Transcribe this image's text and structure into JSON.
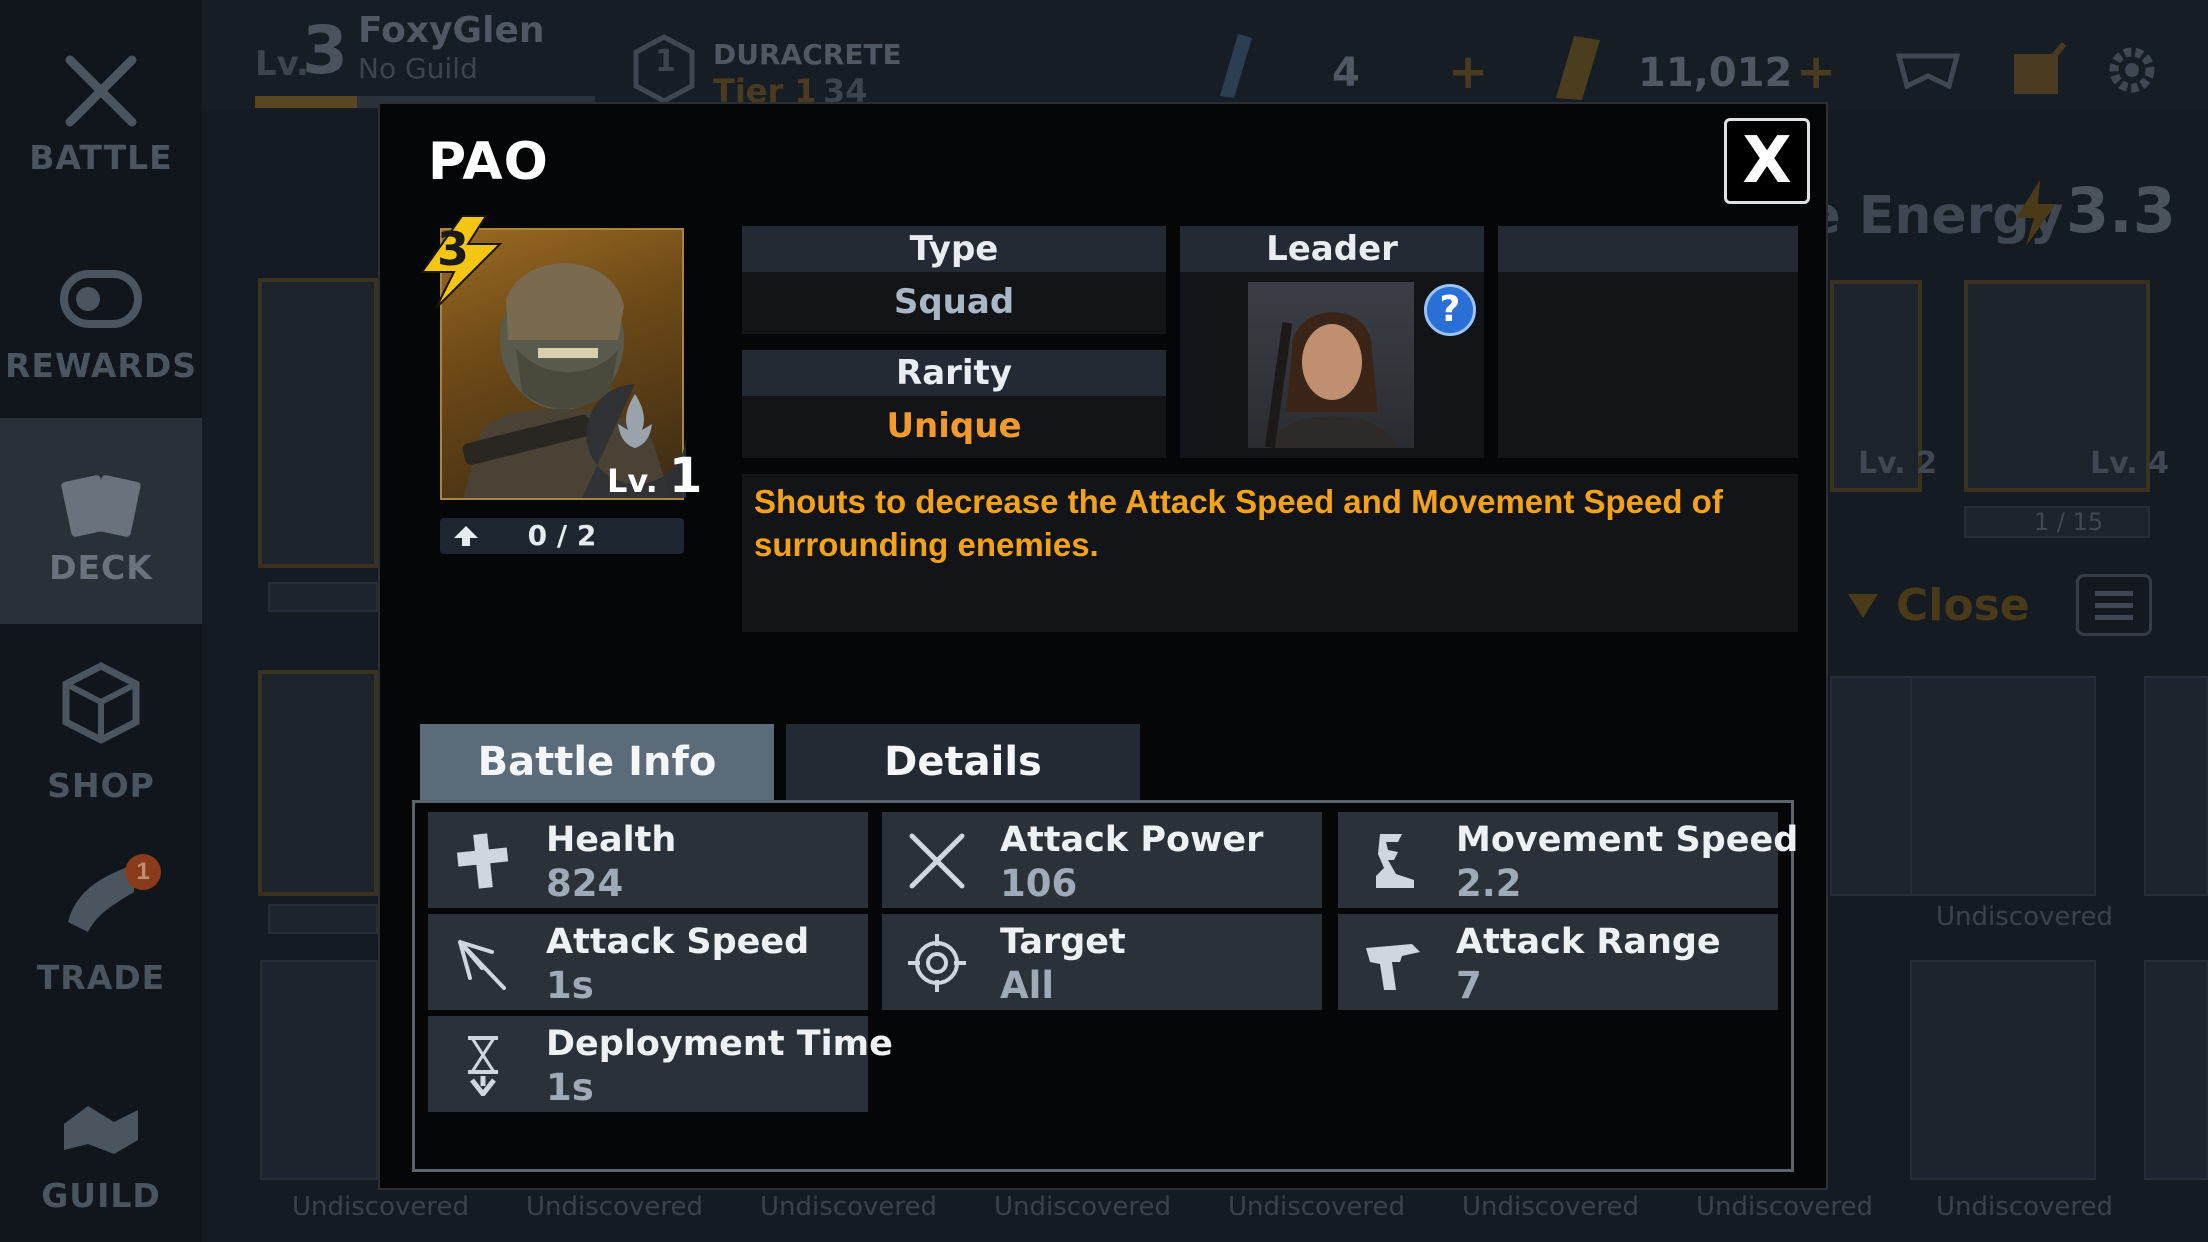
{
  "background": {
    "sidebar": {
      "items": [
        {
          "label": "BATTLE",
          "icon": "battle-icon"
        },
        {
          "label": "REWARDS",
          "icon": "rewards-icon"
        },
        {
          "label": "DECK",
          "icon": "deck-icon"
        },
        {
          "label": "SHOP",
          "icon": "shop-icon"
        },
        {
          "label": "TRADE",
          "icon": "trade-icon",
          "badge": "1"
        },
        {
          "label": "GUILD",
          "icon": "guild-icon"
        }
      ]
    },
    "player": {
      "level_prefix": "Lv.",
      "level": "3",
      "name": "FoxyGlen",
      "guild": "No Guild"
    },
    "league": {
      "name": "DURACRETE",
      "tier": "Tier 1",
      "points": "34",
      "rank_number": "1"
    },
    "currency": {
      "crystals": "4",
      "credits": "11,012",
      "plus": "+"
    },
    "deck": {
      "avg_label": "Average Energy Cost",
      "avg_value": "3.3",
      "sort_label": "Close",
      "card_levels": [
        "Lv. 2",
        "Lv. 4"
      ],
      "card_progress": "1 / 15",
      "undiscovered": "Undiscovered"
    }
  },
  "modal": {
    "title": "PAO",
    "close_label": "X",
    "card": {
      "energy_cost": "3",
      "level_prefix": "Lv.",
      "level": "1",
      "shards": "0 / 2",
      "shards_progress": 0
    },
    "type": {
      "label": "Type",
      "value": "Squad"
    },
    "rarity": {
      "label": "Rarity",
      "value": "Unique"
    },
    "leader": {
      "label": "Leader",
      "help": "?"
    },
    "description": "Shouts to decrease the Attack Speed and Movement Speed of surrounding enemies.",
    "tabs": [
      {
        "label": "Battle Info",
        "active": true
      },
      {
        "label": "Details",
        "active": false
      }
    ],
    "stats": [
      {
        "label": "Health",
        "value": "824",
        "icon": "health-icon"
      },
      {
        "label": "Attack Power",
        "value": "106",
        "icon": "attack-power-icon"
      },
      {
        "label": "Movement Speed",
        "value": "2.2",
        "icon": "movement-speed-icon"
      },
      {
        "label": "Attack Speed",
        "value": "1s",
        "icon": "attack-speed-icon"
      },
      {
        "label": "Target",
        "value": "All",
        "icon": "target-icon"
      },
      {
        "label": "Attack Range",
        "value": "7",
        "icon": "attack-range-icon"
      },
      {
        "label": "Deployment Time",
        "value": "1s",
        "icon": "deployment-time-icon"
      }
    ],
    "colors": {
      "rarity": "#f29a2b",
      "description": "#f4a319",
      "active_tab": "#5c6b79"
    }
  }
}
